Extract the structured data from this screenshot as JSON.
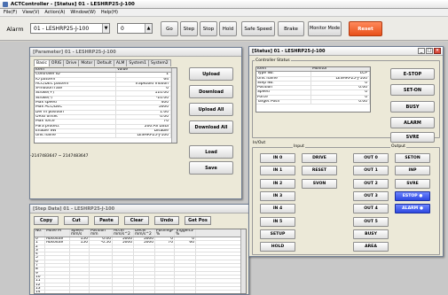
{
  "app": {
    "title": "ACTController - [Status] 01 - LESHRP25-J-100"
  },
  "menu": [
    "File(F)",
    "View(V)",
    "Action(A)",
    "Window(W)",
    "Help(H)"
  ],
  "toolbar": {
    "alarm": "Alarm",
    "axis_value": "01 - LESHRP25-J-100",
    "step_value": "0",
    "go": "Go",
    "step": "Step",
    "stop": "Stop",
    "hold": "Hold",
    "safe_speed": "Safe Speed",
    "brake": "Brake",
    "monitor_mode": "Monitor Mode",
    "reset": "Reset"
  },
  "parameter": {
    "title": "[Parameter] 01 - LESHRP25-J-100",
    "tabs": [
      "Basic",
      "ORIG",
      "Drive",
      "Motor",
      "Default",
      "ALM",
      "System1",
      "System2"
    ],
    "header": [
      "Item",
      "Value"
    ],
    "rows": [
      [
        "Controller ID",
        "1"
      ],
      [
        "IO pattern",
        "64"
      ],
      [
        "ACC/DEC pattern",
        "Trapezoid motion"
      ],
      [
        "S-motion rate",
        "0"
      ],
      [
        "Stroke(+)",
        "110.00"
      ],
      [
        "Stroke(-)",
        "-10.00"
      ],
      [
        "Max speed",
        "400"
      ],
      [
        "Max ACC/DEC",
        "5000"
      ],
      [
        "Def In position",
        "1.00"
      ],
      [
        "ORIG offset",
        "0.00"
      ],
      [
        "Max force",
        "70"
      ],
      [
        "Para protect",
        "200:All Data"
      ],
      [
        "Enable SW",
        "Disable"
      ],
      [
        "Unit name",
        "LESHRP25-J-100"
      ]
    ],
    "buttons": [
      "Upload",
      "Download",
      "Upload All",
      "Download All",
      "Load",
      "Save"
    ],
    "range": "-2147483647 ~ 2147483647"
  },
  "stepdata": {
    "title": "[Step Data] 01 - LESHRP25-J-100",
    "buttons": [
      "Copy",
      "Cut",
      "Paste",
      "Clear",
      "Undo",
      "Get Pos"
    ],
    "header": [
      "No.",
      "Move M",
      "Speed\nmm/s",
      "Position\nmm",
      "Accel\nmm/s^2",
      "Decel\nmm/s^2",
      "PushingF\n%",
      "TriggerLV\n%"
    ],
    "rows": [
      [
        "0",
        "Absolute",
        "150",
        "0.00",
        "5000",
        "5000",
        "0",
        "0"
      ],
      [
        "1",
        "Absolute",
        "150",
        "-0.50",
        "5000",
        "5000",
        "70",
        "60"
      ],
      [
        "2",
        "",
        "",
        "",
        "",
        "",
        "",
        ""
      ],
      [
        "3",
        "",
        "",
        "",
        "",
        "",
        "",
        ""
      ],
      [
        "4",
        "",
        "",
        "",
        "",
        "",
        "",
        ""
      ],
      [
        "5",
        "",
        "",
        "",
        "",
        "",
        "",
        ""
      ],
      [
        "6",
        "",
        "",
        "",
        "",
        "",
        "",
        ""
      ],
      [
        "7",
        "",
        "",
        "",
        "",
        "",
        "",
        ""
      ],
      [
        "8",
        "",
        "",
        "",
        "",
        "",
        "",
        ""
      ],
      [
        "9",
        "",
        "",
        "",
        "",
        "",
        "",
        ""
      ],
      [
        "10",
        "",
        "",
        "",
        "",
        "",
        "",
        ""
      ],
      [
        "11",
        "",
        "",
        "",
        "",
        "",
        "",
        ""
      ],
      [
        "12",
        "",
        "",
        "",
        "",
        "",
        "",
        ""
      ],
      [
        "13",
        "",
        "",
        "",
        "",
        "",
        "",
        ""
      ],
      [
        "14",
        "",
        "",
        "",
        "",
        "",
        "",
        ""
      ]
    ]
  },
  "status": {
    "title": "[Status] 01 - LESHRP25-J-100",
    "controller_status": "Controller Status",
    "header": [
      "Item",
      "Monitor"
    ],
    "rows": [
      [
        "Type No.",
        "LCP"
      ],
      [
        "Unit name",
        "LESHRP25-J-100"
      ],
      [
        "Step No.",
        "0"
      ],
      [
        "Position",
        "0.00"
      ],
      [
        "Speed",
        "0"
      ],
      [
        "Force",
        "0"
      ],
      [
        "Target Posn",
        "0.00"
      ]
    ],
    "side_buttons": [
      "E-STOP",
      "SET-ON",
      "BUSY",
      "ALARM",
      "SVRE"
    ],
    "inout": "In/Out",
    "input_label": "Input",
    "output_label": "Output",
    "inputs_col1": [
      "IN 0",
      "IN 1",
      "IN 2",
      "IN 3",
      "IN 4",
      "IN 5",
      "SETUP",
      "HOLD"
    ],
    "inputs_col2": [
      "DRIVE",
      "RESET",
      "SVON"
    ],
    "outputs_col1": [
      "OUT 0",
      "OUT 1",
      "OUT 2",
      "OUT 3",
      "OUT 4",
      "OUT 5",
      "BUSY",
      "AREA"
    ],
    "outputs_col2": [
      "SETON",
      "INP",
      "SVRE",
      "ESTOP ●",
      "ALARM ●"
    ]
  }
}
